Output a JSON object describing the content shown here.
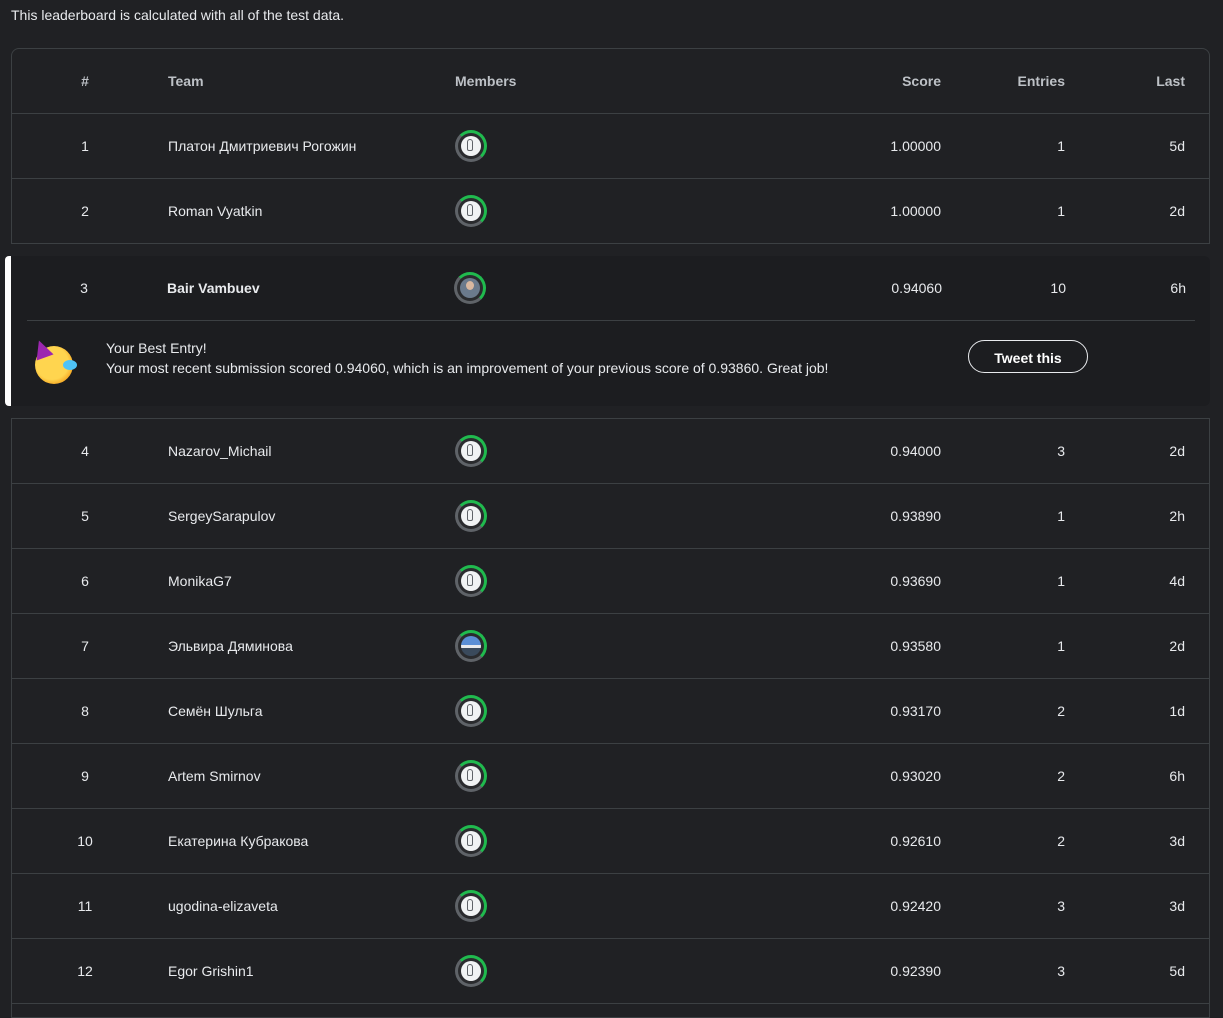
{
  "note": "This leaderboard is calculated with all of the test data.",
  "headers": {
    "rank": "#",
    "team": "Team",
    "members": "Members",
    "score": "Score",
    "entries": "Entries",
    "last": "Last"
  },
  "rows": [
    {
      "rank": "1",
      "team": "Платон Дмитриевич Рогожин",
      "avatar": "default",
      "score": "1.00000",
      "entries": "1",
      "last": "5d"
    },
    {
      "rank": "2",
      "team": "Roman Vyatkin",
      "avatar": "default",
      "score": "1.00000",
      "entries": "1",
      "last": "2d"
    },
    {
      "rank": "3",
      "team": "Bair Vambuev",
      "avatar": "photo",
      "score": "0.94060",
      "entries": "10",
      "last": "6h"
    },
    {
      "rank": "4",
      "team": "Nazarov_Michail",
      "avatar": "default",
      "score": "0.94000",
      "entries": "3",
      "last": "2d"
    },
    {
      "rank": "5",
      "team": "SergeySarapulov",
      "avatar": "default",
      "score": "0.93890",
      "entries": "1",
      "last": "2h"
    },
    {
      "rank": "6",
      "team": "MonikaG7",
      "avatar": "default",
      "score": "0.93690",
      "entries": "1",
      "last": "4d"
    },
    {
      "rank": "7",
      "team": "Эльвира Дяминова",
      "avatar": "landscape",
      "score": "0.93580",
      "entries": "1",
      "last": "2d"
    },
    {
      "rank": "8",
      "team": "Семён Шульга",
      "avatar": "default",
      "score": "0.93170",
      "entries": "2",
      "last": "1d"
    },
    {
      "rank": "9",
      "team": "Artem Smirnov",
      "avatar": "default",
      "score": "0.93020",
      "entries": "2",
      "last": "6h"
    },
    {
      "rank": "10",
      "team": "Екатерина Кубракова",
      "avatar": "default",
      "score": "0.92610",
      "entries": "2",
      "last": "3d"
    },
    {
      "rank": "11",
      "team": "ugodina-elizaveta",
      "avatar": "default",
      "score": "0.92420",
      "entries": "3",
      "last": "3d"
    },
    {
      "rank": "12",
      "team": "Egor Grishin1",
      "avatar": "default",
      "score": "0.92390",
      "entries": "3",
      "last": "5d"
    }
  ],
  "best_entry": {
    "emoji": "partying-face-icon",
    "title": "Your Best Entry!",
    "message": "Your most recent submission scored 0.94060, which is an improvement of your previous score of 0.93860. Great job!",
    "tweet_label": "Tweet this"
  },
  "colors": {
    "background": "#202124",
    "accent": "#20ba4e",
    "border": "#3c4043"
  }
}
